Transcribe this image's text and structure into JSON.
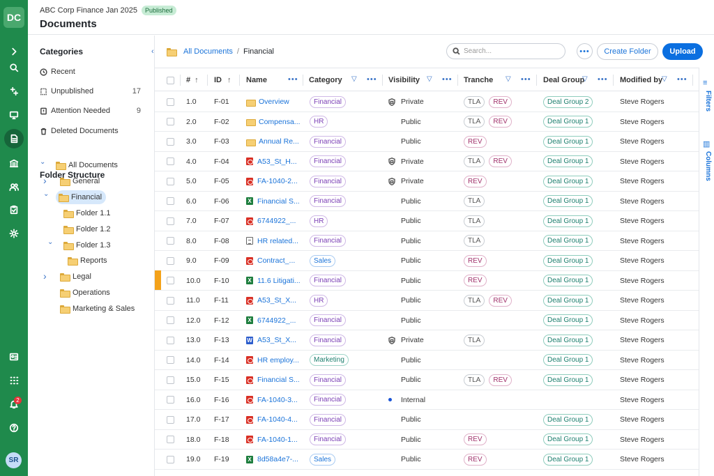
{
  "app": {
    "logo": "DC",
    "user_initials": "SR",
    "notifications": "2"
  },
  "header": {
    "workspace": "ABC Corp Finance Jan 2025",
    "status": "Published",
    "title": "Documents"
  },
  "categories": {
    "title": "Categories",
    "items": [
      {
        "label": "Recent",
        "count": "",
        "icon": "clock-icon"
      },
      {
        "label": "Unpublished",
        "count": "17",
        "icon": "dashed-doc-icon"
      },
      {
        "label": "Attention Needed",
        "count": "9",
        "icon": "alert-icon"
      },
      {
        "label": "Deleted Documents",
        "count": "",
        "icon": "trash-icon"
      }
    ]
  },
  "folders": {
    "title": "Folder Structure",
    "items": [
      {
        "label": "All Documents",
        "level": 0,
        "chevron": "down"
      },
      {
        "label": "General",
        "level": 1,
        "chevron": "right"
      },
      {
        "label": "Financial",
        "level": 1,
        "chevron": "down",
        "selected": true
      },
      {
        "label": "Folder 1.1",
        "level": 2,
        "chevron": ""
      },
      {
        "label": "Folder 1.2",
        "level": 2,
        "chevron": ""
      },
      {
        "label": "Folder 1.3",
        "level": 2,
        "chevron": "down"
      },
      {
        "label": "Reports",
        "level": 3,
        "chevron": ""
      },
      {
        "label": "Legal",
        "level": 1,
        "chevron": "right"
      },
      {
        "label": "Operations",
        "level": 1,
        "chevron": ""
      },
      {
        "label": "Marketing & Sales",
        "level": 1,
        "chevron": ""
      }
    ]
  },
  "breadcrumb": {
    "root": "All Documents",
    "sep": "/",
    "current": "Financial"
  },
  "toolbar": {
    "search_placeholder": "Search...",
    "more": "•••",
    "create_folder": "Create Folder",
    "upload": "Upload"
  },
  "table": {
    "columns": {
      "num": "#",
      "id": "ID",
      "name": "Name",
      "category": "Category",
      "visibility": "Visibility",
      "tranche": "Tranche",
      "deal_group": "Deal Group",
      "modified_by": "Modified by"
    },
    "rows": [
      {
        "num": "1.0",
        "id": "F-01",
        "type": "folder",
        "name": "Overview",
        "category": "Financial",
        "visibility": "Private",
        "vis_icon": "lock",
        "tranche": [
          "TLA",
          "REV"
        ],
        "deal_group": "Deal Group 2",
        "modified_by": "Steve Rogers"
      },
      {
        "num": "2.0",
        "id": "F-02",
        "type": "folder",
        "name": "Compensa...",
        "category": "HR",
        "visibility": "Public",
        "vis_icon": "",
        "tranche": [
          "TLA",
          "REV"
        ],
        "deal_group": "Deal Group 1",
        "modified_by": "Steve Rogers"
      },
      {
        "num": "3.0",
        "id": "F-03",
        "type": "folder",
        "name": "Annual Re...",
        "category": "Financial",
        "visibility": "Public",
        "vis_icon": "",
        "tranche": [
          "REV"
        ],
        "deal_group": "Deal Group 1",
        "modified_by": "Steve Rogers"
      },
      {
        "num": "4.0",
        "id": "F-04",
        "type": "pdf",
        "name": "A53_St_H...",
        "category": "Financial",
        "visibility": "Private",
        "vis_icon": "lock",
        "tranche": [
          "TLA",
          "REV"
        ],
        "deal_group": "Deal Group 1",
        "modified_by": "Steve Rogers"
      },
      {
        "num": "5.0",
        "id": "F-05",
        "type": "pdf",
        "name": "FA-1040-2...",
        "category": "Financial",
        "visibility": "Private",
        "vis_icon": "lock",
        "tranche": [
          "REV"
        ],
        "deal_group": "Deal Group 1",
        "modified_by": "Steve Rogers"
      },
      {
        "num": "6.0",
        "id": "F-06",
        "type": "xls",
        "name": "Financial S...",
        "category": "Financial",
        "visibility": "Public",
        "vis_icon": "",
        "tranche": [
          "TLA"
        ],
        "deal_group": "Deal Group 1",
        "modified_by": "Steve Rogers"
      },
      {
        "num": "7.0",
        "id": "F-07",
        "type": "pdf",
        "name": "6744922_...",
        "category": "HR",
        "visibility": "Public",
        "vis_icon": "",
        "tranche": [
          "TLA"
        ],
        "deal_group": "Deal Group 1",
        "modified_by": "Steve Rogers"
      },
      {
        "num": "8.0",
        "id": "F-08",
        "type": "txt",
        "name": "HR related...",
        "category": "Financial",
        "visibility": "Public",
        "vis_icon": "",
        "tranche": [
          "TLA"
        ],
        "deal_group": "Deal Group 1",
        "modified_by": "Steve Rogers"
      },
      {
        "num": "9.0",
        "id": "F-09",
        "type": "pdf",
        "name": "Contract_...",
        "category": "Sales",
        "visibility": "Public",
        "vis_icon": "",
        "tranche": [
          "REV"
        ],
        "deal_group": "Deal Group 1",
        "modified_by": "Steve Rogers"
      },
      {
        "num": "10.0",
        "id": "F-10",
        "type": "xls",
        "name": "11.6 Litigati...",
        "category": "Financial",
        "visibility": "Public",
        "vis_icon": "",
        "tranche": [
          "REV"
        ],
        "deal_group": "Deal Group 1",
        "modified_by": "Steve Rogers"
      },
      {
        "num": "11.0",
        "id": "F-11",
        "type": "pdf",
        "name": "A53_St_X...",
        "category": "HR",
        "visibility": "Public",
        "vis_icon": "",
        "tranche": [
          "TLA",
          "REV"
        ],
        "deal_group": "Deal Group 1",
        "modified_by": "Steve Rogers"
      },
      {
        "num": "12.0",
        "id": "F-12",
        "type": "xls",
        "name": "6744922_...",
        "category": "Financial",
        "visibility": "Public",
        "vis_icon": "",
        "tranche": [],
        "deal_group": "Deal Group 1",
        "modified_by": "Steve Rogers"
      },
      {
        "num": "13.0",
        "id": "F-13",
        "type": "doc",
        "name": "A53_St_X...",
        "category": "Financial",
        "visibility": "Private",
        "vis_icon": "lock",
        "tranche": [
          "TLA"
        ],
        "deal_group": "Deal Group 1",
        "modified_by": "Steve Rogers"
      },
      {
        "num": "14.0",
        "id": "F-14",
        "type": "pdf",
        "name": "HR employ...",
        "category": "Marketing",
        "visibility": "Public",
        "vis_icon": "",
        "tranche": [],
        "deal_group": "Deal Group 1",
        "modified_by": "Steve Rogers"
      },
      {
        "num": "15.0",
        "id": "F-15",
        "type": "pdf",
        "name": "Financial S...",
        "category": "Financial",
        "visibility": "Public",
        "vis_icon": "",
        "tranche": [
          "TLA",
          "REV"
        ],
        "deal_group": "Deal Group 1",
        "modified_by": "Steve Rogers"
      },
      {
        "num": "16.0",
        "id": "F-16",
        "type": "pdf",
        "name": "FA-1040-3...",
        "category": "Financial",
        "visibility": "Internal",
        "vis_icon": "dot",
        "tranche": [],
        "deal_group": "",
        "modified_by": "Steve Rogers"
      },
      {
        "num": "17.0",
        "id": "F-17",
        "type": "pdf",
        "name": "FA-1040-4...",
        "category": "Financial",
        "visibility": "Public",
        "vis_icon": "",
        "tranche": [],
        "deal_group": "Deal Group 1",
        "modified_by": "Steve Rogers"
      },
      {
        "num": "18.0",
        "id": "F-18",
        "type": "pdf",
        "name": "FA-1040-1...",
        "category": "Financial",
        "visibility": "Public",
        "vis_icon": "",
        "tranche": [
          "REV"
        ],
        "deal_group": "Deal Group 1",
        "modified_by": "Steve Rogers"
      },
      {
        "num": "19.0",
        "id": "F-19",
        "type": "xls",
        "name": "8d58a4e7-...",
        "category": "Sales",
        "visibility": "Public",
        "vis_icon": "",
        "tranche": [
          "REV"
        ],
        "deal_group": "Deal Group 1",
        "modified_by": "Steve Rogers"
      }
    ]
  },
  "right_panel": {
    "filters": "Filters",
    "columns": "Columns"
  },
  "colors": {
    "rail": "#1f8a4c",
    "accent": "#1a73d9",
    "primary_button": "#0b6fe0",
    "attention_marker": "#f4a21a"
  }
}
